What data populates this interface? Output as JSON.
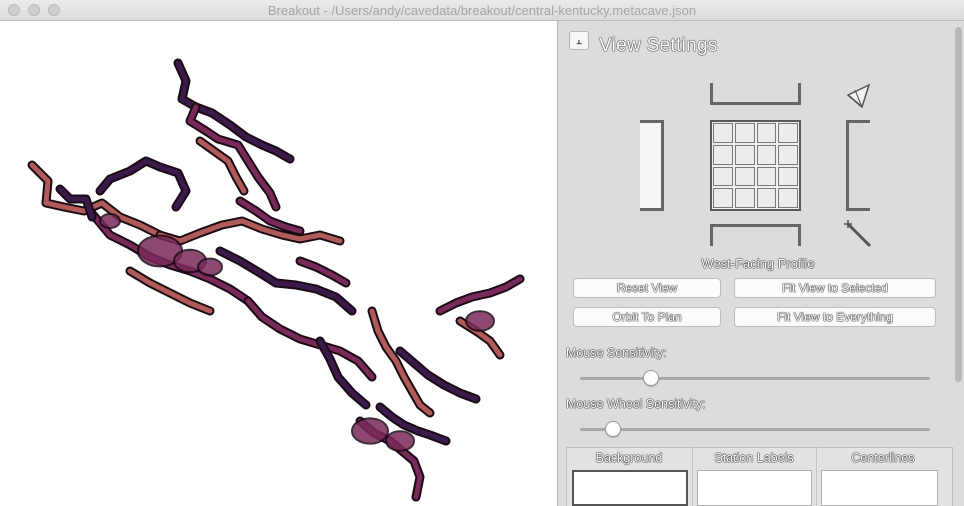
{
  "window": {
    "title": "Breakout - /Users/andy/cavedata/breakout/central-kentucky.metacave.json"
  },
  "colors": {
    "map_background": "#ffffff",
    "cave_outline": "#1a0a14",
    "cave_fill_dark": "#3a1a4a",
    "cave_fill_mid": "#7a2a5a",
    "cave_fill_warm": "#b05a5a",
    "panel_background": "#dcdcdc"
  },
  "panel": {
    "pin_icon": "pin-icon",
    "title": "View Settings",
    "view_cube": {
      "current_view_label": "West-Facing Profile",
      "icons": [
        "perspective-icon",
        "wand-icon"
      ]
    },
    "buttons": {
      "reset_view": "Reset View",
      "fit_selected": "Fit View to Selected",
      "orbit_plan": "Orbit To Plan",
      "fit_everything": "Fit View to Everything"
    },
    "mouse_sensitivity": {
      "label": "Mouse Sensitivity:",
      "value": 0.18
    },
    "wheel_sensitivity": {
      "label": "Mouse Wheel Sensitivity:",
      "value": 0.07
    },
    "color_columns": {
      "background": "Background",
      "station_labels": "Station Labels",
      "centerlines": "Centerlines"
    }
  }
}
